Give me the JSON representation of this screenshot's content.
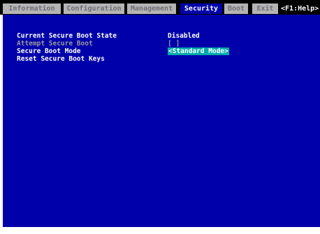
{
  "colors": {
    "menubar_bg": "#000000",
    "tab_bg": "#b4b4b4",
    "tab_active_bg": "#0000aa",
    "content_bg": "#0000aa",
    "selected_value_bg": "#00aaaa"
  },
  "menu": {
    "tabs": [
      {
        "label": "Information"
      },
      {
        "label": "Configuration"
      },
      {
        "label": "Management"
      },
      {
        "label": "Security"
      },
      {
        "label": "Boot"
      },
      {
        "label": "Exit"
      }
    ],
    "active_tab": "Security",
    "help_label": "<F1:Help>"
  },
  "settings": {
    "current_state": {
      "label": "Current Secure Boot State",
      "value": "Disabled"
    },
    "attempt": {
      "label": "Attempt Secure Boot",
      "value": "[ ]"
    },
    "mode": {
      "label": "Secure Boot Mode",
      "value": "<Standard Mode>"
    },
    "reset": {
      "label": "Reset Secure Boot Keys"
    }
  }
}
